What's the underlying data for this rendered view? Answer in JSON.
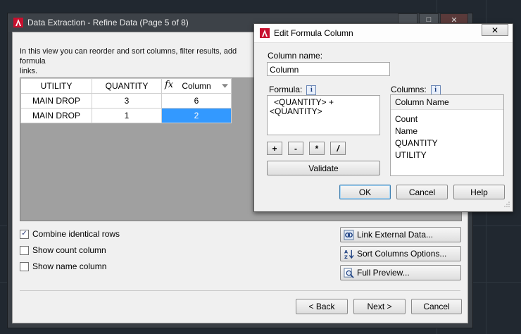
{
  "main_window": {
    "title": "Data Extraction - Refine Data (Page 5 of 8)",
    "window_buttons": [
      "▁",
      "□",
      "✕"
    ],
    "description_line1": "In this view you can reorder and sort columns, filter results, add formula",
    "description_line2": "links.",
    "table": {
      "headers": [
        "UTILITY",
        "QUANTITY",
        "Column"
      ],
      "formula_glyph": "fx",
      "rows": [
        [
          "MAIN DROP",
          "3",
          "6"
        ],
        [
          "MAIN DROP",
          "1",
          "2"
        ]
      ],
      "selected_row": 1
    },
    "checkboxes": [
      {
        "label": "Combine identical rows",
        "checked": true
      },
      {
        "label": "Show count column",
        "checked": false
      },
      {
        "label": "Show name column",
        "checked": false
      }
    ],
    "side_buttons": {
      "link": "Link External Data...",
      "sort": "Sort Columns Options...",
      "preview": "Full Preview..."
    },
    "nav_buttons": {
      "back": "< Back",
      "next": "Next >",
      "cancel": "Cancel"
    }
  },
  "formula_dialog": {
    "title": "Edit Formula Column",
    "close": "✕",
    "column_name_label": "Column name:",
    "column_name_value": "Column",
    "formula_label": "Formula:",
    "formula_line1": "<QUANTITY> +",
    "formula_line2": "<QUANTITY>",
    "operators": [
      "+",
      "-",
      "*",
      "/"
    ],
    "validate": "Validate",
    "columns_label": "Columns:",
    "columns_header": "Column Name",
    "columns": [
      "Count",
      "Name",
      "QUANTITY",
      "UTILITY"
    ],
    "ok": "OK",
    "cancel": "Cancel",
    "help": "Help",
    "info_glyph": "i"
  },
  "colors": {
    "selection": "#3399ff",
    "logo_red": "#c8102e",
    "desktop": "#212830"
  }
}
